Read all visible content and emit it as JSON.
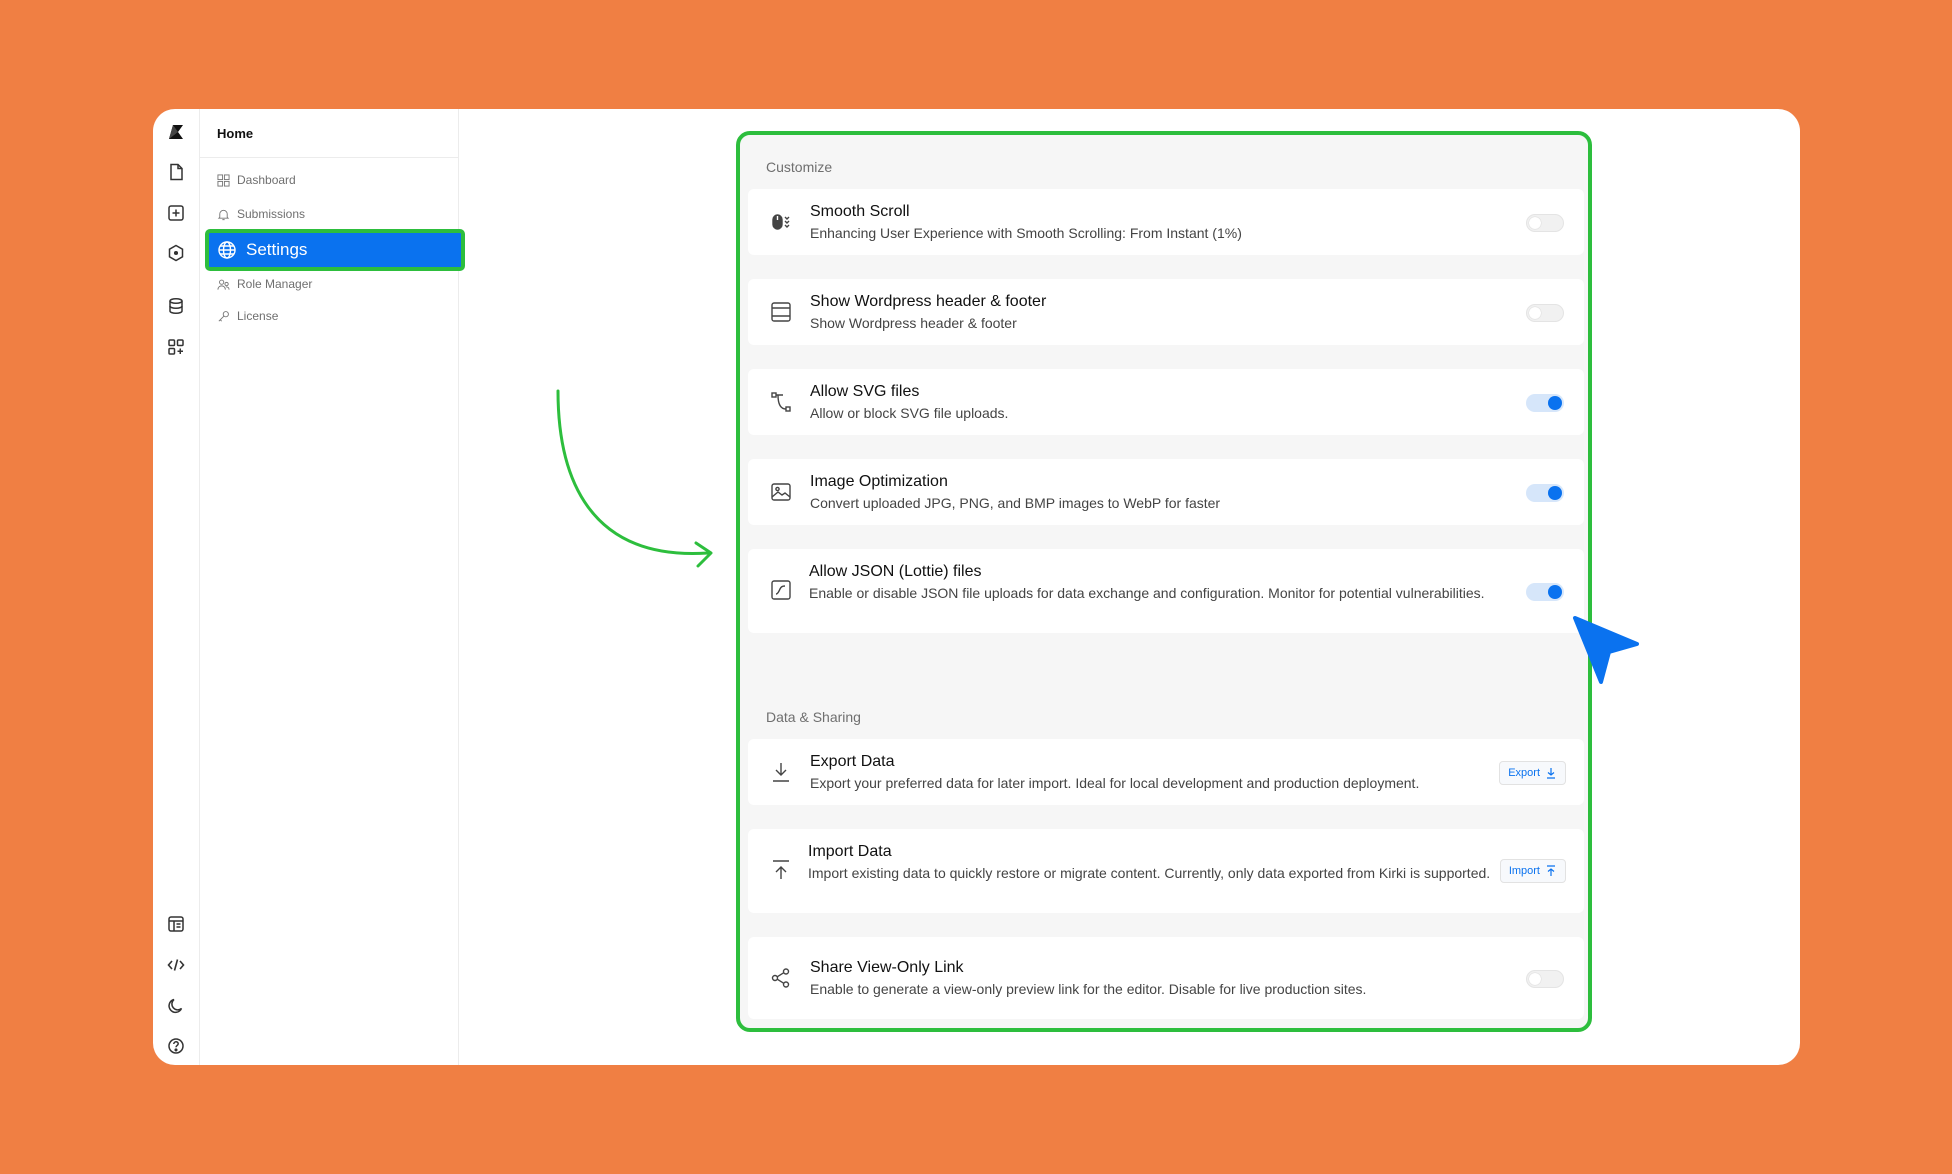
{
  "nav": {
    "title": "Home",
    "items": [
      {
        "label": "Dashboard"
      },
      {
        "label": "Submissions"
      },
      {
        "label": "Settings"
      },
      {
        "label": "Role Manager"
      },
      {
        "label": "License"
      }
    ]
  },
  "customize": {
    "title": "Customize",
    "items": [
      {
        "title": "Smooth Scroll",
        "desc": "Enhancing User Experience with Smooth Scrolling: From Instant (1%)",
        "enabled": false
      },
      {
        "title": "Show Wordpress header & footer",
        "desc": "Show Wordpress header & footer",
        "enabled": false
      },
      {
        "title": "Allow SVG files",
        "desc": "Allow or block SVG file uploads.",
        "enabled": true
      },
      {
        "title": "Image Optimization",
        "desc": "Convert uploaded JPG, PNG, and BMP images to WebP for faster",
        "enabled": true
      },
      {
        "title": "Allow JSON (Lottie) files",
        "desc": "Enable or disable JSON file uploads for data exchange and configuration. Monitor for potential vulnerabilities.",
        "enabled": true
      }
    ]
  },
  "data_sharing": {
    "title": "Data & Sharing",
    "items": [
      {
        "title": "Export Data",
        "desc": "Export your preferred data for later import. Ideal for local development and production deployment.",
        "button": "Export"
      },
      {
        "title": "Import Data",
        "desc": "Import existing data to quickly restore or migrate content. Currently, only data exported from Kirki is supported.",
        "button": "Import"
      },
      {
        "title": "Share View-Only Link",
        "desc": "Enable to generate a view-only preview link for the editor. Disable for live production sites.",
        "enabled": false
      }
    ]
  },
  "colors": {
    "background": "#F07F43",
    "accent": "#0A72EF",
    "highlight": "#2DBE3D"
  }
}
